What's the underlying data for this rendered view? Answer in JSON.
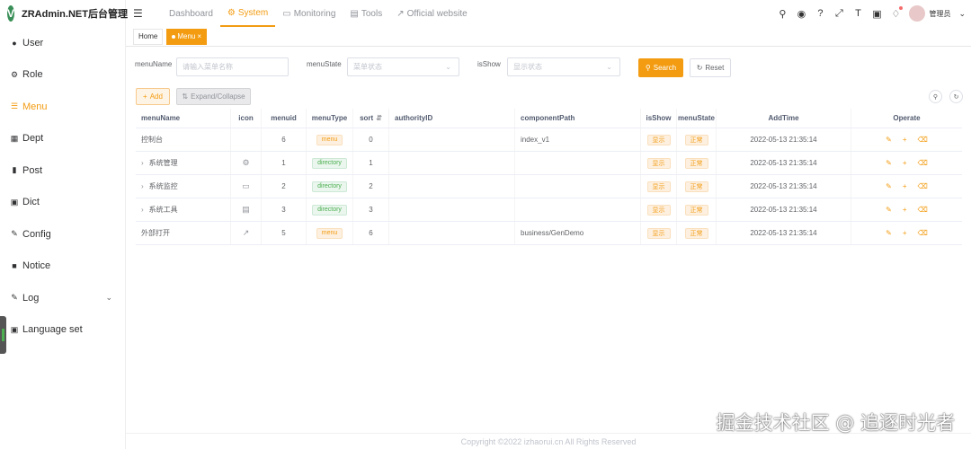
{
  "app": {
    "logo_letter": "V",
    "title": "ZRAdmin.NET后台管理"
  },
  "sidebar": {
    "items": [
      {
        "label": "User",
        "icon": "user-icon"
      },
      {
        "label": "Role",
        "icon": "role-icon"
      },
      {
        "label": "Menu",
        "icon": "tree-icon",
        "active": true
      },
      {
        "label": "Dept",
        "icon": "dept-icon"
      },
      {
        "label": "Post",
        "icon": "post-icon"
      },
      {
        "label": "Dict",
        "icon": "dict-icon"
      },
      {
        "label": "Config",
        "icon": "config-icon"
      },
      {
        "label": "Notice",
        "icon": "message-icon"
      },
      {
        "label": "Log",
        "icon": "log-icon",
        "expandable": true
      },
      {
        "label": "Language set",
        "icon": "language-icon"
      }
    ]
  },
  "topnav": {
    "items": [
      {
        "label": "Dashboard"
      },
      {
        "label": "System",
        "active": true
      },
      {
        "label": "Monitoring"
      },
      {
        "label": "Tools"
      },
      {
        "label": "Official website"
      }
    ],
    "username": "管理员"
  },
  "tags": {
    "home": "Home",
    "current": "Menu"
  },
  "search": {
    "menuName_label": "menuName",
    "menuName_placeholder": "请输入菜单名称",
    "menuState_label": "menuState",
    "menuState_placeholder": "菜单状态",
    "isShow_label": "isShow",
    "isShow_placeholder": "显示状态",
    "search_label": "Search",
    "reset_label": "Reset"
  },
  "actions": {
    "add_label": "Add",
    "expand_label": "Expand/Collapse"
  },
  "table": {
    "headers": {
      "menuName": "menuName",
      "icon": "icon",
      "menuid": "menuid",
      "menuType": "menuType",
      "sort": "sort",
      "authorityID": "authorityID",
      "componentPath": "componentPath",
      "isShow": "isShow",
      "menuState": "menuState",
      "addTime": "AddTime",
      "operate": "Operate"
    },
    "rows": [
      {
        "name": "控制台",
        "expandable": false,
        "icon": "",
        "id": "6",
        "type": "menu",
        "sort": "0",
        "auth": "",
        "path": "index_v1",
        "show": "显示",
        "state": "正常",
        "time": "2022-05-13 21:35:14"
      },
      {
        "name": "系统管理",
        "expandable": true,
        "icon": "gear-icon",
        "id": "1",
        "type": "directory",
        "sort": "1",
        "auth": "",
        "path": "",
        "show": "显示",
        "state": "正常",
        "time": "2022-05-13 21:35:14"
      },
      {
        "name": "系统监控",
        "expandable": true,
        "icon": "monitor-icon",
        "id": "2",
        "type": "directory",
        "sort": "2",
        "auth": "",
        "path": "",
        "show": "显示",
        "state": "正常",
        "time": "2022-05-13 21:35:14"
      },
      {
        "name": "系统工具",
        "expandable": true,
        "icon": "toolbox-icon",
        "id": "3",
        "type": "directory",
        "sort": "3",
        "auth": "",
        "path": "",
        "show": "显示",
        "state": "正常",
        "time": "2022-05-13 21:35:14"
      },
      {
        "name": "外部打开",
        "expandable": false,
        "icon": "external-link-icon",
        "id": "5",
        "type": "menu",
        "sort": "6",
        "auth": "",
        "path": "business/GenDemo",
        "show": "显示",
        "state": "正常",
        "time": "2022-05-13 21:35:14"
      }
    ]
  },
  "footer": "Copyright ©2022 izhaorui.cn All Rights Reserved",
  "watermark": "掘金技术社区 @ 追逐时光者",
  "colors": {
    "accent": "#f39c12",
    "directory": "#4caf50"
  }
}
